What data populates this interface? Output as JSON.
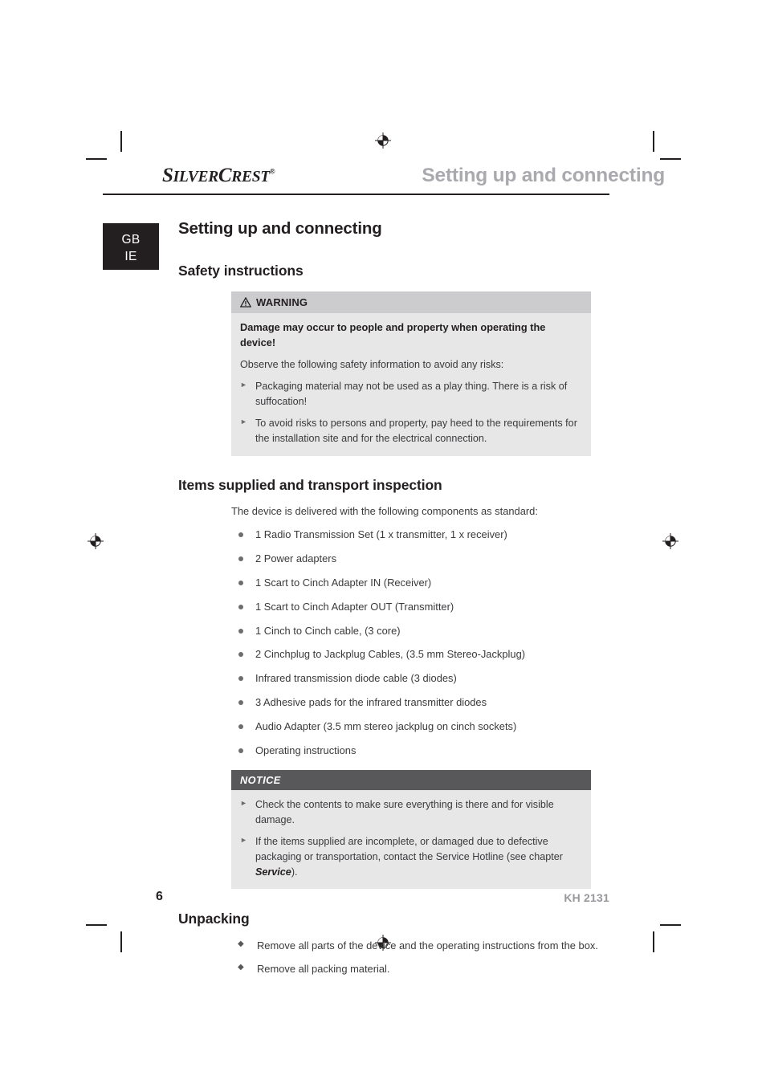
{
  "header": {
    "logo_primary": "S",
    "logo_silver": "ILVER",
    "logo_c": "C",
    "logo_rest": "REST",
    "logo_registered": "®",
    "running_title": "Setting up and connecting",
    "language_tab": [
      "GB",
      "IE"
    ]
  },
  "main": {
    "section_title": "Setting up and connecting",
    "safety": {
      "heading": "Safety instructions",
      "warning_label": "WARNING",
      "warning_icon": "warning-triangle-icon",
      "lead": "Damage may occur to people and property when operating the device!",
      "observe": "Observe the following safety information to avoid any risks:",
      "bullets": [
        "Packaging material may not be used as a play thing. There is a risk of suffocation!",
        "To avoid risks to persons and property, pay heed to the requirements for the installation site and for the electrical connection."
      ]
    },
    "items_supplied": {
      "heading": "Items supplied and transport inspection",
      "intro": "The device is delivered with the following components as standard:",
      "items": [
        "1 Radio Transmission Set (1 x transmitter, 1 x receiver)",
        "2 Power adapters",
        "1 Scart to Cinch Adapter IN (Receiver)",
        "1 Scart to Cinch Adapter OUT (Transmitter)",
        "1 Cinch to Cinch cable, (3 core)",
        "2 Cinchplug to Jackplug Cables, (3.5 mm Stereo-Jackplug)",
        "Infrared transmission diode cable (3 diodes)",
        "3 Adhesive pads for the infrared transmitter diodes",
        "Audio Adapter (3.5 mm stereo jackplug on cinch sockets)",
        "Operating instructions"
      ]
    },
    "notice": {
      "label": "NOTICE",
      "bullets": [
        "Check the contents to make sure everything is there and for visible damage."
      ],
      "bullet2_part1": "If the items supplied are incomplete, or damaged due to defective packaging or transportation, contact the Service Hotline (see chapter ",
      "bullet2_emphasis": "Service",
      "bullet2_part2": ")."
    },
    "unpacking": {
      "heading": "Unpacking",
      "items": [
        "Remove all parts of the device and the operating instructions from the box.",
        "Remove all packing material."
      ]
    }
  },
  "footer": {
    "page_number": "6",
    "model": "KH 2131"
  },
  "colors": {
    "ink": "#231f20",
    "running_title_gray": "#a9a9ae",
    "box_body_bg": "#e7e7e8",
    "warning_head_bg": "#ccccce",
    "notice_head_bg": "#58585a",
    "footer_model_gray": "#98989d"
  }
}
